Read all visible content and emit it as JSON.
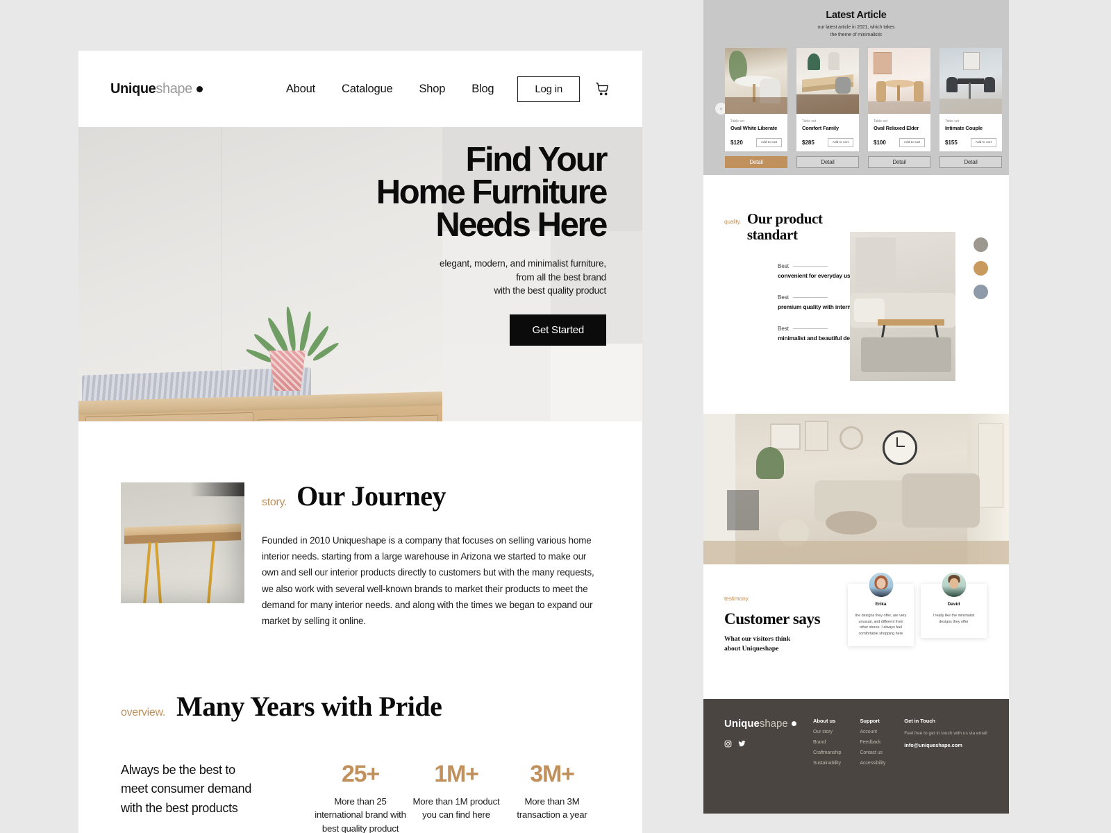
{
  "brand": {
    "bold": "Unique",
    "light": "shape",
    "dot": "●"
  },
  "nav": {
    "links": [
      {
        "label": "About"
      },
      {
        "label": "Catalogue"
      },
      {
        "label": "Shop"
      },
      {
        "label": "Blog"
      }
    ],
    "login_label": "Log in",
    "cart_icon": "cart-icon"
  },
  "hero": {
    "title_line1": "Find Your",
    "title_line2": "Home Furniture",
    "title_line3": "Needs Here",
    "sub_line1": "elegant, modern, and minimalist furniture,",
    "sub_line2": "from all the best brand",
    "sub_line3": "with the best quality product",
    "cta_label": "Get Started"
  },
  "journey": {
    "eyebrow": "story.",
    "title": "Our Journey",
    "paragraph": "Founded in 2010 Uniqueshape is a company that focuses on selling various home interior needs. starting from a large warehouse in Arizona we started to make our own and sell our interior products directly to customers but with the many requests, we also work with several well-known brands to market their products to meet the demand for many interior needs. and along with the times we began to expand our market by selling it online."
  },
  "overview": {
    "eyebrow": "overview.",
    "title": "Many Years with Pride",
    "lead": "Always be the best to meet consumer demand with the best products",
    "stats": [
      {
        "number": "25+",
        "text": "More than 25 international brand with best quality product"
      },
      {
        "number": "1M+",
        "text": "More than 1M product you can find here"
      },
      {
        "number": "3M+",
        "text": "More than 3M transaction a year"
      }
    ]
  },
  "article": {
    "title": "Latest Article",
    "sub_line1": "our latest article in 2021, which takes",
    "sub_line2": "the theme of minimalistic",
    "prev_icon": "chevron-left-icon",
    "next_icon": "chevron-right-icon",
    "products": [
      {
        "category": "Table set",
        "name": "Oval White Liberate",
        "price": "$120",
        "add_label": "Add to cart",
        "detail_label": "Detail",
        "active": true
      },
      {
        "category": "Table set",
        "name": "Comfort Family",
        "price": "$285",
        "add_label": "Add to cart",
        "detail_label": "Detail",
        "active": false
      },
      {
        "category": "Table set",
        "name": "Oval Relaxed Elder",
        "price": "$100",
        "add_label": "Add to cart",
        "detail_label": "Detail",
        "active": false
      },
      {
        "category": "Table set",
        "name": "Intimate Couple",
        "price": "$155",
        "add_label": "Add to cart",
        "detail_label": "Detail",
        "active": false
      }
    ]
  },
  "standart": {
    "eyebrow": "quality.",
    "title_line1": "Our product",
    "title_line2": "standart",
    "items": [
      {
        "label": "Best",
        "text": "convenient for everyday use"
      },
      {
        "label": "Best",
        "text": "premium quality with international standards"
      },
      {
        "label": "Best",
        "text": "minimalist and beautiful design"
      }
    ],
    "swatches": [
      "#9c9890",
      "#c89a5e",
      "#8f9aa8"
    ]
  },
  "testimony": {
    "eyebrow": "testimony.",
    "title": "Customer says",
    "sub_line1": "What our visitors think",
    "sub_line2": "about Uniqueshape",
    "cards": [
      {
        "name": "Erika",
        "text": "the designs they offer, are very unusual, and different from other stores. I always feel comfortable shopping here"
      },
      {
        "name": "David",
        "text": "I really like the minimalist designs they offer"
      }
    ]
  },
  "footer": {
    "columns": [
      {
        "heading": "About us",
        "items": [
          "Our story",
          "Brand",
          "Craftmanship",
          "Sustainability"
        ]
      },
      {
        "heading": "Support",
        "items": [
          "Account",
          "Feedback",
          "Contact us",
          "Accessibility"
        ]
      }
    ],
    "touch": {
      "heading": "Get in Touch",
      "note": "Feel free to get in touch with us via email",
      "email": "info@uniqueshape.com"
    },
    "social": [
      "instagram-icon",
      "twitter-icon"
    ]
  },
  "colors": {
    "accent": "#c0915c",
    "dark": "#0b0b0b",
    "footer_bg": "#4a4540"
  }
}
